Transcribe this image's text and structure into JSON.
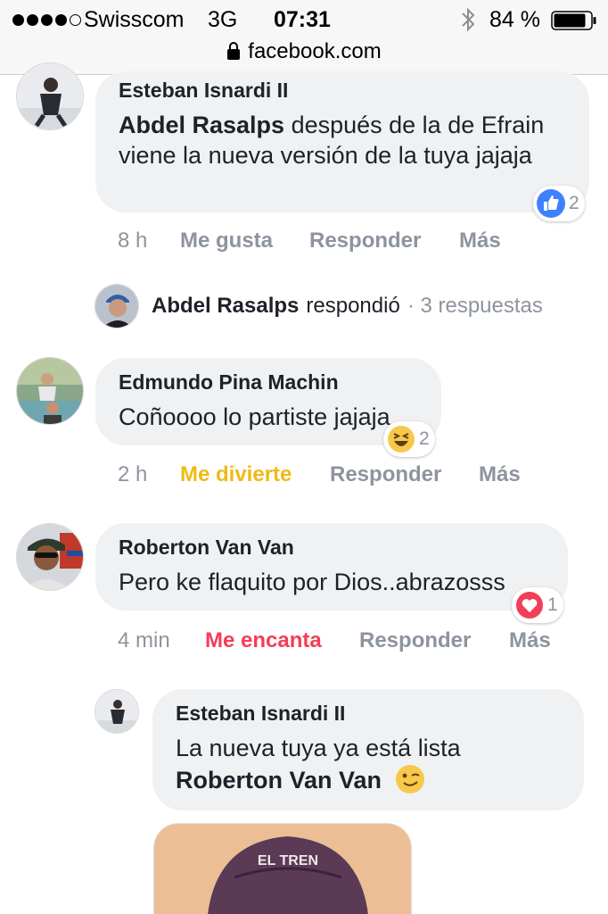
{
  "status_bar": {
    "carrier": "Swisscom",
    "network": "3G",
    "time": "07:31",
    "battery": "84 %",
    "icons": [
      "signal-dots-icon",
      "bluetooth-icon",
      "battery-icon"
    ]
  },
  "url_bar": {
    "url": "facebook.com",
    "icon": "lock-icon"
  },
  "comments": [
    {
      "author": "Esteban Isnardi II",
      "mention": "Abdel Rasalps",
      "text": " después de la de Efrain viene la nueva versión de la tuya jajaja",
      "reaction": {
        "type": "like",
        "count": "2",
        "color": "#4080ff"
      },
      "time": "8 h",
      "actions": [
        "Me gusta",
        "Responder",
        "Más"
      ]
    },
    {
      "replies_summary": {
        "name": "Abdel Rasalps",
        "verb": "respondió",
        "count": "· 3 respuestas"
      }
    },
    {
      "author": "Edmundo Pina Machin",
      "text": "Coñoooo lo partiste jajaja",
      "reaction": {
        "type": "haha",
        "count": "2",
        "color": "#f7c94b"
      },
      "time": "2 h",
      "actions": [
        "Me divierte",
        "Responder",
        "Más"
      ]
    },
    {
      "author": "Roberton Van Van",
      "text": "Pero ke flaquito por Dios..abrazosss",
      "reaction": {
        "type": "love",
        "count": "1",
        "color": "#f33e58"
      },
      "time": "4 min",
      "actions": [
        "Me encanta",
        "Responder",
        "Más"
      ]
    },
    {
      "author": "Esteban Isnardi II",
      "text": "La nueva tuya ya está lista ",
      "mention": "Roberton Van Van",
      "emoji": "wink-emoji-icon",
      "attachment_caption": "EL TREN"
    }
  ]
}
